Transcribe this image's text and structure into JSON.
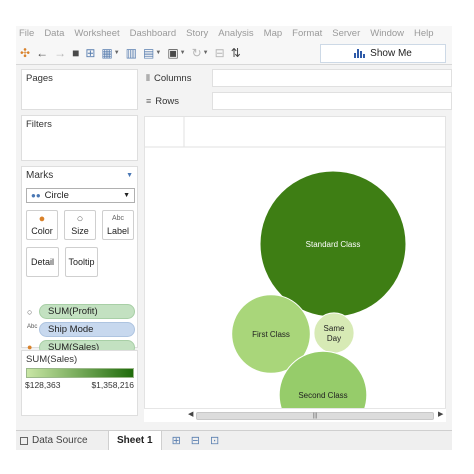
{
  "menu": [
    "File",
    "Data",
    "Worksheet",
    "Dashboard",
    "Story",
    "Analysis",
    "Map",
    "Format",
    "Server",
    "Window",
    "Help"
  ],
  "toolbar": {
    "icons": [
      "tableau-logo-icon",
      "undo-icon",
      "redo-icon",
      "save-icon",
      "new-data-source-icon",
      "new-worksheet-icon",
      "duplicate-icon",
      "clear-icon",
      "sort-icon",
      "refresh-icon",
      "group-icon",
      "swap-icon"
    ],
    "show_me_label": "Show Me"
  },
  "panels": {
    "pages_title": "Pages",
    "filters_title": "Filters"
  },
  "marks": {
    "title": "Marks",
    "mark_type": "Circle",
    "buttons": {
      "color": "Color",
      "size": "Size",
      "label": "Label",
      "detail": "Detail",
      "tooltip": "Tooltip"
    },
    "fields": [
      {
        "label": "SUM(Profit)",
        "encoding": "size",
        "style": "green"
      },
      {
        "label": "Ship Mode",
        "encoding": "label",
        "style": "blue"
      },
      {
        "label": "SUM(Sales)",
        "encoding": "color",
        "style": "green"
      }
    ]
  },
  "legend": {
    "title": "SUM(Sales)",
    "min_label": "$128,363",
    "max_label": "$1,358,216",
    "color_low": "#c9e6a5",
    "color_high": "#1f6b0b"
  },
  "shelves": {
    "columns_label": "Columns",
    "rows_label": "Rows"
  },
  "chart_data": {
    "type": "bubble",
    "size_field": "SUM(Profit)",
    "color_field": "SUM(Sales)",
    "label_field": "Ship Mode",
    "bubbles": [
      {
        "label": "Standard Class",
        "size": 1.0,
        "color": "#3e7e14",
        "label_color": "#ffffff"
      },
      {
        "label": "First Class",
        "size": 0.29,
        "color": "#a9d67a",
        "label_color": "#222222"
      },
      {
        "label": "Same Day",
        "size": 0.076,
        "color": "#d7eab5",
        "label_color": "#222222"
      },
      {
        "label": "Second Class",
        "size": 0.36,
        "color": "#96cc6a",
        "label_color": "#222222"
      }
    ]
  },
  "tabs": {
    "data_source": "Data Source",
    "sheet1": "Sheet 1"
  }
}
